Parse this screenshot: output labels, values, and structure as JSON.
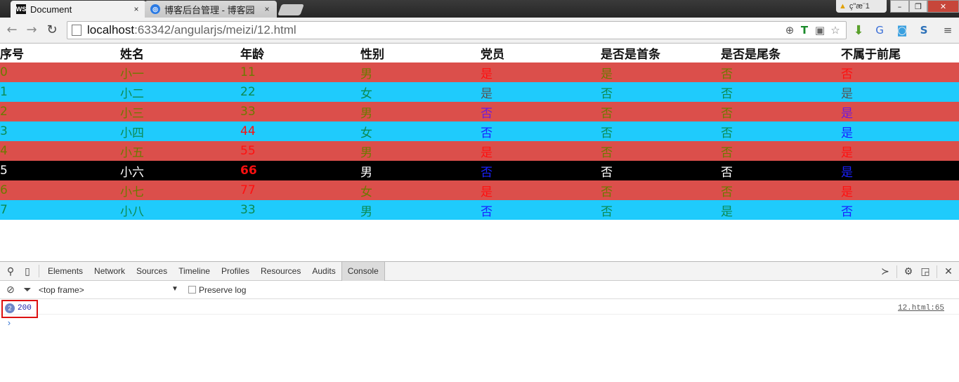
{
  "browser": {
    "tabs": [
      {
        "favicon": "WS",
        "title": "Document",
        "close": "×"
      },
      {
        "favicon": "◎",
        "title": "博客后台管理 - 博客园",
        "close": "×"
      }
    ],
    "warning_text": "ç\"æ¨1",
    "window_buttons": {
      "minimize": "–",
      "restore": "❐",
      "close": "✕"
    },
    "nav": {
      "back": "←",
      "forward": "→",
      "reload": "↻"
    },
    "url_host": "localhost",
    "url_rest": ":63342/angularjs/meizi/12.html"
  },
  "table": {
    "headers": [
      "序号",
      "姓名",
      "年龄",
      "性别",
      "党员",
      "是否是首条",
      "是否是尾条",
      "不属于前尾"
    ],
    "rows": [
      {
        "cells": [
          "0",
          "小一",
          "11",
          "男",
          "是",
          "是",
          "否",
          "否"
        ]
      },
      {
        "cells": [
          "1",
          "小二",
          "22",
          "女",
          "是",
          "否",
          "否",
          "是"
        ]
      },
      {
        "cells": [
          "2",
          "小三",
          "33",
          "男",
          "否",
          "否",
          "否",
          "是"
        ]
      },
      {
        "cells": [
          "3",
          "小四",
          "44",
          "女",
          "否",
          "否",
          "否",
          "是"
        ]
      },
      {
        "cells": [
          "4",
          "小五",
          "55",
          "男",
          "是",
          "否",
          "否",
          "是"
        ]
      },
      {
        "cells": [
          "5",
          "小六",
          "66",
          "男",
          "否",
          "否",
          "否",
          "是"
        ]
      },
      {
        "cells": [
          "6",
          "小七",
          "77",
          "女",
          "是",
          "否",
          "否",
          "是"
        ]
      },
      {
        "cells": [
          "7",
          "小八",
          "33",
          "男",
          "否",
          "否",
          "是",
          "否"
        ]
      }
    ],
    "colors": {
      "red_row_bg": "#db4f4b",
      "blue_row_bg": "#1fcbfc",
      "selected_row_bg": "#000000",
      "olive_text": "#6b7a00",
      "green_text": "#0c8a52",
      "red_text": "#ff1010",
      "blue_text": "#1a20ff",
      "purple_text": "#6a1be0",
      "gray_text": "#555555"
    }
  },
  "devtools": {
    "tabs": [
      "Elements",
      "Network",
      "Sources",
      "Timeline",
      "Profiles",
      "Resources",
      "Audits",
      "Console"
    ],
    "selected_tab": "Console",
    "frame_select": "<top frame>",
    "preserve_log_label": "Preserve log",
    "log": {
      "count": "2",
      "value": "200",
      "source": "12.html:65"
    },
    "prompt_symbol": "›"
  }
}
